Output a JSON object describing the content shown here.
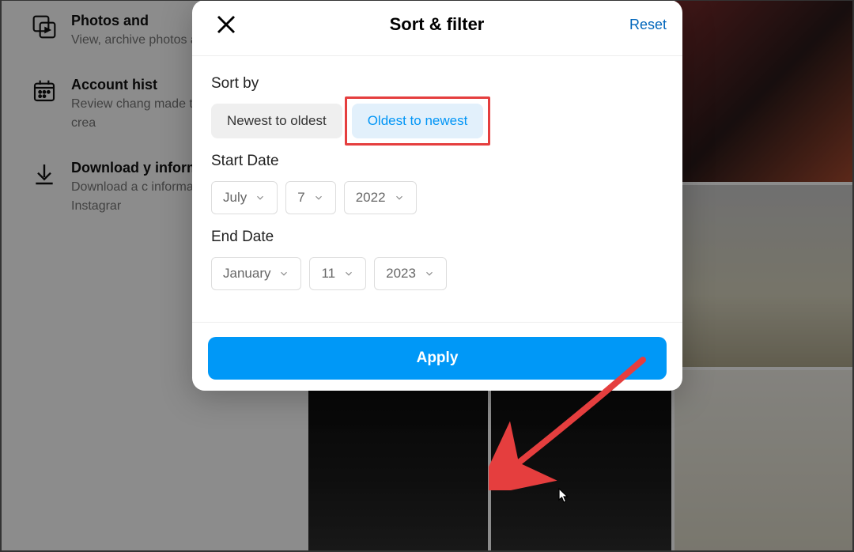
{
  "bg": {
    "items": [
      {
        "title": "Photos and",
        "desc": "View, archive photos and vi shared."
      },
      {
        "title": "Account hist",
        "desc": "Review chang made to your since you crea"
      },
      {
        "title": "Download y information",
        "desc": "Download a c information yo with Instagrar"
      }
    ]
  },
  "modal": {
    "title": "Sort & filter",
    "reset": "Reset",
    "sort_label": "Sort by",
    "sort_newest": "Newest to oldest",
    "sort_oldest": "Oldest to newest",
    "start_label": "Start Date",
    "start": {
      "month": "July",
      "day": "7",
      "year": "2022"
    },
    "end_label": "End Date",
    "end": {
      "month": "January",
      "day": "11",
      "year": "2023"
    },
    "apply": "Apply"
  },
  "highlight_color": "#e53e3e"
}
